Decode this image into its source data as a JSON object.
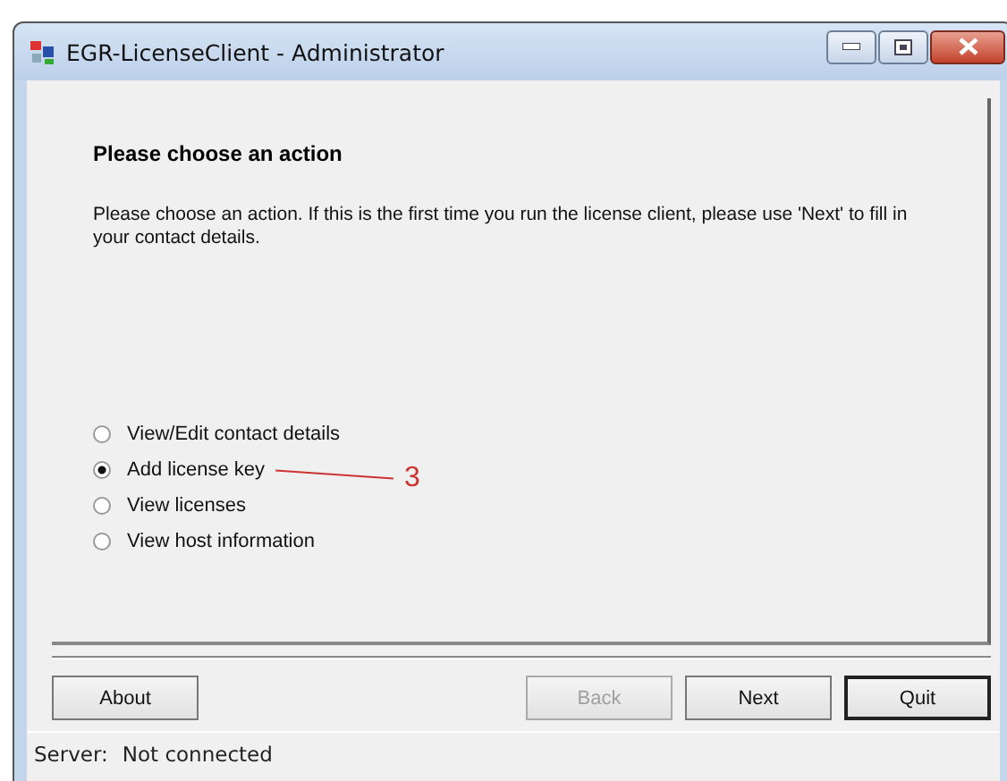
{
  "window": {
    "title": "EGR-LicenseClient - Administrator"
  },
  "page": {
    "heading": "Please choose an action",
    "description": "Please choose an action. If this is the first time you run the license client, please use 'Next' to fill in your contact details."
  },
  "options": [
    {
      "label": "View/Edit contact details",
      "selected": false
    },
    {
      "label": "Add license key",
      "selected": true
    },
    {
      "label": "View licenses",
      "selected": false
    },
    {
      "label": "View host information",
      "selected": false
    }
  ],
  "annotation": {
    "text": "3"
  },
  "buttons": [
    {
      "label": "About",
      "disabled": false,
      "default": false
    },
    {
      "label": "Back",
      "disabled": true,
      "default": false
    },
    {
      "label": "Next",
      "disabled": false,
      "default": false
    },
    {
      "label": "Quit",
      "disabled": false,
      "default": true
    }
  ],
  "status_bar": {
    "label": "Server:",
    "value": "Not connected"
  }
}
